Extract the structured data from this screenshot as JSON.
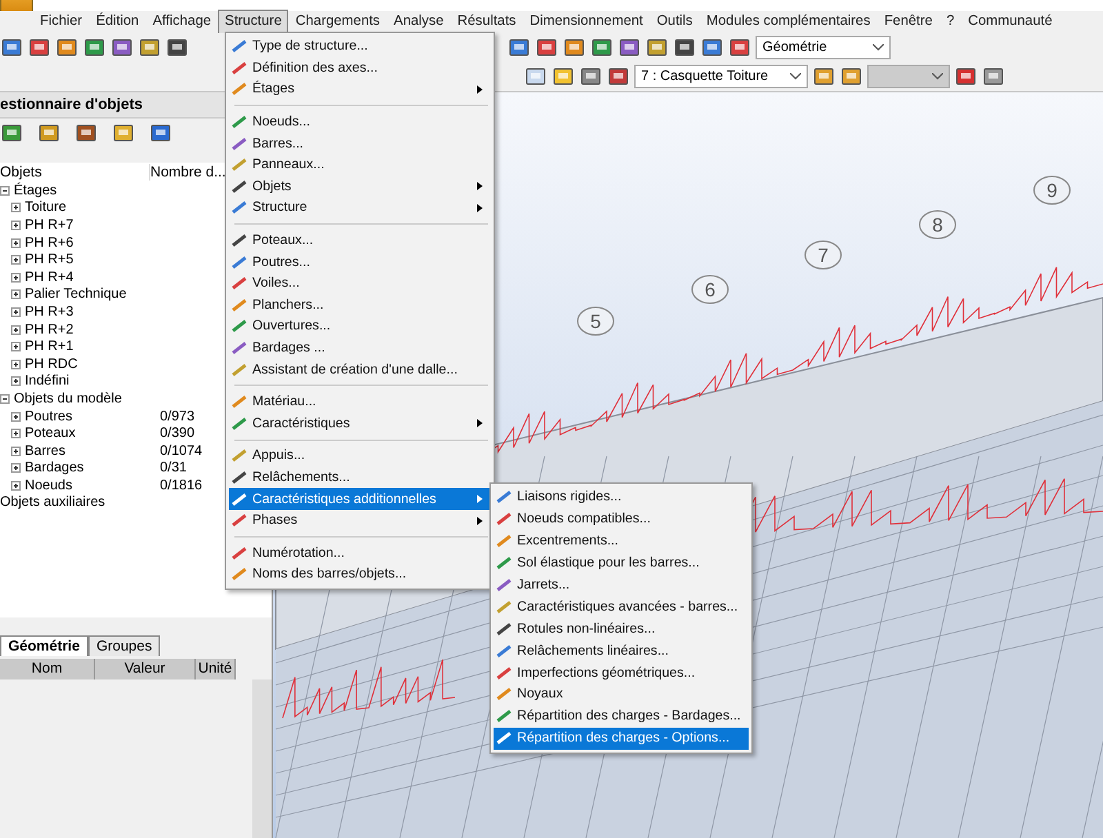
{
  "menu_bar": [
    {
      "label": "Fichier",
      "selected": false
    },
    {
      "label": "Édition",
      "selected": false
    },
    {
      "label": "Affichage",
      "selected": false
    },
    {
      "label": "Structure",
      "selected": true
    },
    {
      "label": "Chargements",
      "selected": false
    },
    {
      "label": "Analyse",
      "selected": false
    },
    {
      "label": "Résultats",
      "selected": false
    },
    {
      "label": "Dimensionnement",
      "selected": false
    },
    {
      "label": "Outils",
      "selected": false
    },
    {
      "label": "Modules complémentaires",
      "selected": false
    },
    {
      "label": "Fenêtre",
      "selected": false
    },
    {
      "label": "?",
      "selected": false
    },
    {
      "label": "Communauté",
      "selected": false
    }
  ],
  "toolbar": {
    "view_select": {
      "value": "Géométrie",
      "disabled": false
    },
    "story_select": {
      "value": "7 : Casquette Toiture",
      "disabled": false
    },
    "extra_select": {
      "disabled": true
    }
  },
  "object_manager": {
    "title": "estionnaire d'objets",
    "columns": [
      "Objets",
      "Nombre d..."
    ],
    "tree": [
      {
        "label": "Étages",
        "expanded": true,
        "children": [
          {
            "label": "Toiture"
          },
          {
            "label": "PH R+7"
          },
          {
            "label": "PH R+6"
          },
          {
            "label": "PH R+5"
          },
          {
            "label": "PH R+4"
          },
          {
            "label": "Palier Technique"
          },
          {
            "label": "PH R+3"
          },
          {
            "label": "PH R+2"
          },
          {
            "label": "PH R+1"
          },
          {
            "label": "PH RDC"
          },
          {
            "label": "Indéfini"
          }
        ]
      },
      {
        "label": "Objets du modèle",
        "expanded": true,
        "children": [
          {
            "label": "Poutres",
            "count": "0/973"
          },
          {
            "label": "Poteaux",
            "count": "0/390"
          },
          {
            "label": "Barres",
            "count": "0/1074"
          },
          {
            "label": "Bardages",
            "count": "0/31"
          },
          {
            "label": "Noeuds",
            "count": "0/1816"
          }
        ]
      },
      {
        "label": "Objets auxiliaires"
      }
    ]
  },
  "properties": {
    "tabs": [
      {
        "label": "Géométrie",
        "selected": true
      },
      {
        "label": "Groupes",
        "selected": false
      }
    ],
    "columns": [
      "Nom",
      "Valeur",
      "Unité"
    ]
  },
  "viewport": {
    "axis_labels": [
      "5",
      "6",
      "7",
      "8",
      "9"
    ]
  },
  "structure_menu": [
    [
      {
        "label": "Type de structure...",
        "submenu": false,
        "selected": false
      },
      {
        "label": "Définition des axes...",
        "submenu": false,
        "selected": false
      },
      {
        "label": "Étages",
        "submenu": true,
        "selected": false
      }
    ],
    [
      {
        "label": "Noeuds...",
        "submenu": false,
        "selected": false
      },
      {
        "label": "Barres...",
        "submenu": false,
        "selected": false
      },
      {
        "label": "Panneaux...",
        "submenu": false,
        "selected": false
      },
      {
        "label": "Objets",
        "submenu": true,
        "selected": false
      },
      {
        "label": "Structure",
        "submenu": true,
        "selected": false
      }
    ],
    [
      {
        "label": "Poteaux...",
        "submenu": false,
        "selected": false
      },
      {
        "label": "Poutres...",
        "submenu": false,
        "selected": false
      },
      {
        "label": "Voiles...",
        "submenu": false,
        "selected": false
      },
      {
        "label": "Planchers...",
        "submenu": false,
        "selected": false
      },
      {
        "label": "Ouvertures...",
        "submenu": false,
        "selected": false
      },
      {
        "label": "Bardages ...",
        "submenu": false,
        "selected": false
      },
      {
        "label": "Assistant de création d'une dalle...",
        "submenu": false,
        "selected": false
      }
    ],
    [
      {
        "label": "Matériau...",
        "submenu": false,
        "selected": false
      },
      {
        "label": "Caractéristiques",
        "submenu": true,
        "selected": false
      }
    ],
    [
      {
        "label": "Appuis...",
        "submenu": false,
        "selected": false
      },
      {
        "label": "Relâchements...",
        "submenu": false,
        "selected": false
      },
      {
        "label": "Caractéristiques additionnelles",
        "submenu": true,
        "selected": true
      },
      {
        "label": "Phases",
        "submenu": true,
        "selected": false
      }
    ],
    [
      {
        "label": "Numérotation...",
        "submenu": false,
        "selected": false
      },
      {
        "label": "Noms des barres/objets...",
        "submenu": false,
        "selected": false
      }
    ]
  ],
  "submenu": [
    {
      "label": "Liaisons rigides...",
      "selected": false
    },
    {
      "label": "Noeuds compatibles...",
      "selected": false
    },
    {
      "label": "Excentrements...",
      "selected": false
    },
    {
      "label": "Sol élastique pour les barres...",
      "selected": false
    },
    {
      "label": "Jarrets...",
      "selected": false
    },
    {
      "label": "Caractéristiques avancées - barres...",
      "selected": false
    },
    {
      "label": "Rotules non-linéaires...",
      "selected": false
    },
    {
      "label": "Relâchements linéaires...",
      "selected": false
    },
    {
      "label": "Imperfections géométriques...",
      "selected": false
    },
    {
      "label": "Noyaux",
      "selected": false
    },
    {
      "label": "Répartition des charges - Bardages...",
      "selected": false
    },
    {
      "label": "Répartition des charges - Options...",
      "selected": true
    }
  ]
}
